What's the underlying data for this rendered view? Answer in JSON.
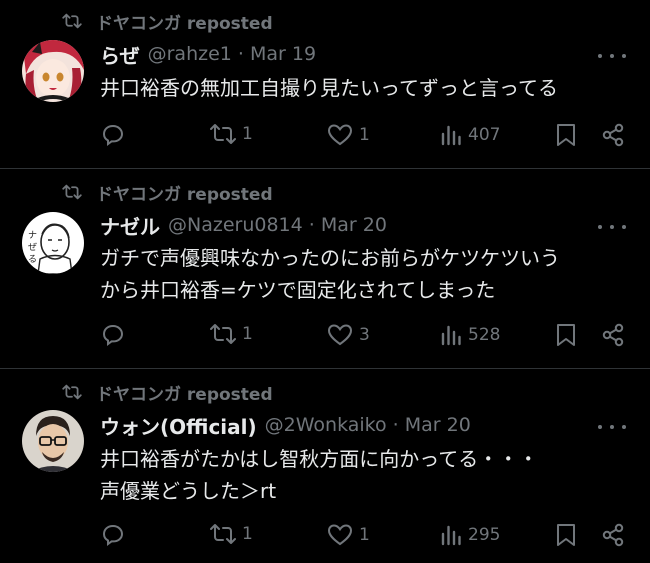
{
  "tweets": [
    {
      "reposted_by": "ドヤコンガ reposted",
      "name": "らぜ",
      "handle": "@rahze1 · Mar 19",
      "lines": [
        "井口裕香の無加工自撮り見たいってずっと言ってる"
      ],
      "reposts": "1",
      "likes": "1",
      "views": "407"
    },
    {
      "reposted_by": "ドヤコンガ reposted",
      "name": "ナゼル",
      "handle": "@Nazeru0814 · Mar 20",
      "lines": [
        "ガチで声優興味なかったのにお前らがケツケツいう",
        "から井口裕香=ケツで固定化されてしまった"
      ],
      "reposts": "1",
      "likes": "3",
      "views": "528"
    },
    {
      "reposted_by": "ドヤコンガ reposted",
      "name": "ウォン(Official)",
      "handle": "@2Wonkaiko · Mar 20",
      "lines": [
        "井口裕香がたかはし智秋方面に向かってる・・・",
        "声優業どうした＞rt"
      ],
      "reposts": "1",
      "likes": "1",
      "views": "295"
    }
  ],
  "icons": [
    "repost-icon",
    "reply-icon",
    "retweet-icon",
    "like-icon",
    "views-icon",
    "bookmark-icon",
    "share-icon",
    "more-icon"
  ],
  "colors": {
    "background": "#000000",
    "text": "#e7e9ea",
    "muted": "#71767b",
    "separator": "#2f3336"
  }
}
